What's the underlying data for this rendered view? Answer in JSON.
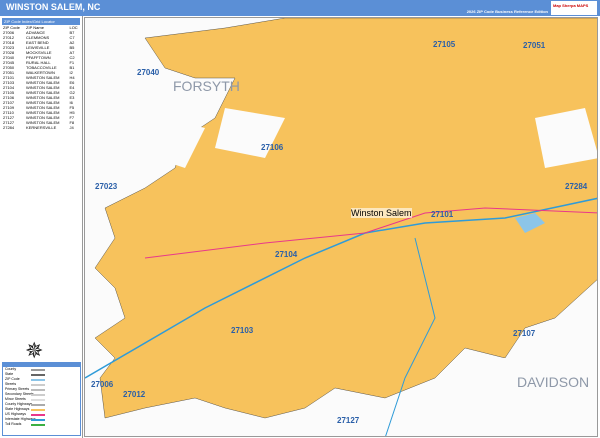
{
  "header": {
    "title": "WINSTON SALEM, NC",
    "edition": "2026 ZIP Code Business Reference Edition",
    "logo": "Map Sherpa MAPS"
  },
  "index": {
    "title": "ZIP Code Index/Grid Locator",
    "columns": [
      "ZIP Code",
      "ZIP Name",
      "LOC"
    ],
    "rows": [
      [
        "27006",
        "ADVANCE",
        "B7"
      ],
      [
        "27012",
        "CLEMMONS",
        "C7"
      ],
      [
        "27018",
        "EAST BEND",
        "A2"
      ],
      [
        "27023",
        "LEWISVILLE",
        "B5"
      ],
      [
        "27028",
        "MOCKSVILLE",
        "A7"
      ],
      [
        "27040",
        "PFAFFTOWN",
        "C2"
      ],
      [
        "27045",
        "RURAL HALL",
        "F1"
      ],
      [
        "27050",
        "TOBACCOVILLE",
        "B1"
      ],
      [
        "27051",
        "WALKERTOWN",
        "I2"
      ],
      [
        "27101",
        "WINSTON SALEM",
        "H4"
      ],
      [
        "27103",
        "WINSTON SALEM",
        "E6"
      ],
      [
        "27104",
        "WINSTON SALEM",
        "E4"
      ],
      [
        "27105",
        "WINSTON SALEM",
        "G2"
      ],
      [
        "27106",
        "WINSTON SALEM",
        "E3"
      ],
      [
        "27107",
        "WINSTON SALEM",
        "I6"
      ],
      [
        "27109",
        "WINSTON SALEM",
        "F5"
      ],
      [
        "27110",
        "WINSTON SALEM",
        "H5"
      ],
      [
        "27127",
        "WINSTON SALEM",
        "F7"
      ],
      [
        "27127",
        "WINSTON SALEM",
        "F8"
      ],
      [
        "27284",
        "KERNERSVILLE",
        "J4"
      ]
    ]
  },
  "legend": {
    "items": [
      "County",
      "State",
      "ZIP Code",
      "Streets",
      "Primary Streets",
      "Secondary Streets",
      "Minor Streets",
      "County Highways",
      "State Highways",
      "US Highways",
      "Interstate Highways",
      "Toll Roads"
    ],
    "colors": {
      "zip_area": "#f7c25c",
      "header": "#5b8fd6",
      "zip_label": "#2a5fa8",
      "interstate": "#2f9bd8",
      "us_highway": "#e8388a"
    }
  },
  "map": {
    "city": "Winston Salem",
    "counties": [
      "FORSYTH",
      "DAVIDSON"
    ],
    "zips": [
      {
        "code": "27040"
      },
      {
        "code": "27105"
      },
      {
        "code": "27051"
      },
      {
        "code": "27106"
      },
      {
        "code": "27023"
      },
      {
        "code": "27101"
      },
      {
        "code": "27284"
      },
      {
        "code": "27104"
      },
      {
        "code": "27103"
      },
      {
        "code": "27107"
      },
      {
        "code": "27006"
      },
      {
        "code": "27012"
      },
      {
        "code": "27127"
      }
    ]
  }
}
